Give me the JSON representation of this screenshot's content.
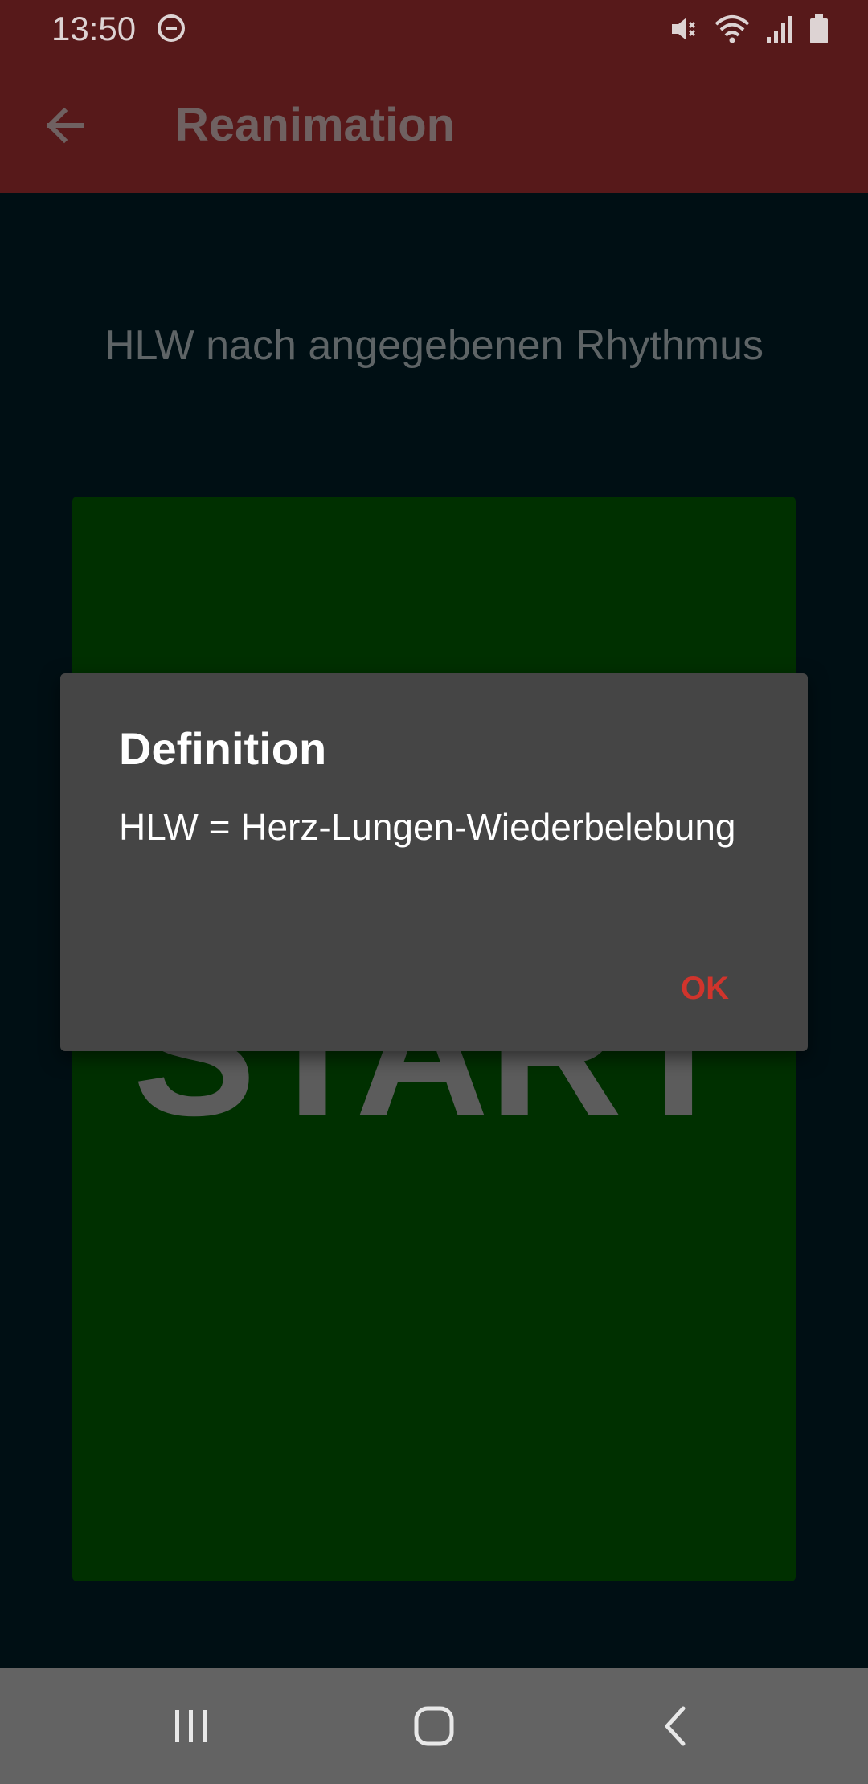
{
  "status_bar": {
    "time": "13:50",
    "icons": [
      "do-not-disturb-icon",
      "mute-icon",
      "wifi-icon",
      "signal-icon",
      "battery-icon"
    ]
  },
  "app_bar": {
    "title": "Reanimation",
    "back_icon": "arrow-left-icon"
  },
  "content": {
    "instruction": "HLW nach angegebenen Rhythmus",
    "start_button_label": "START"
  },
  "dialog": {
    "title": "Definition",
    "message": "HLW = Herz-Lungen-Wiederbelebung",
    "ok_label": "OK"
  },
  "nav_bar": {
    "icons": [
      "recent-apps-icon",
      "home-icon",
      "back-icon"
    ]
  },
  "colors": {
    "app_bar": "#57191a",
    "background": "#000f14",
    "start_area": "#003000",
    "dialog": "#454545",
    "accent": "#d0342c",
    "nav_bar": "#636363"
  }
}
